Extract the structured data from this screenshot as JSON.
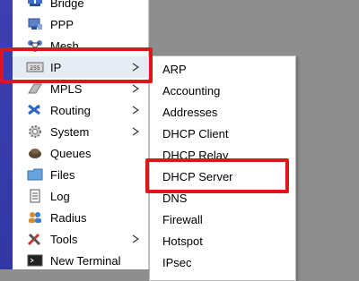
{
  "main_menu": {
    "items": [
      {
        "label": "Bridge",
        "icon": "bridge-icon",
        "has_submenu": false
      },
      {
        "label": "PPP",
        "icon": "ppp-icon",
        "has_submenu": false
      },
      {
        "label": "Mesh",
        "icon": "mesh-icon",
        "has_submenu": false
      },
      {
        "label": "IP",
        "icon": "ip-icon",
        "has_submenu": true,
        "selected": true
      },
      {
        "label": "MPLS",
        "icon": "mpls-icon",
        "has_submenu": true
      },
      {
        "label": "Routing",
        "icon": "routing-icon",
        "has_submenu": true
      },
      {
        "label": "System",
        "icon": "system-icon",
        "has_submenu": true
      },
      {
        "label": "Queues",
        "icon": "queues-icon",
        "has_submenu": false
      },
      {
        "label": "Files",
        "icon": "files-icon",
        "has_submenu": false
      },
      {
        "label": "Log",
        "icon": "log-icon",
        "has_submenu": false
      },
      {
        "label": "Radius",
        "icon": "radius-icon",
        "has_submenu": false
      },
      {
        "label": "Tools",
        "icon": "tools-icon",
        "has_submenu": true
      },
      {
        "label": "New Terminal",
        "icon": "terminal-icon",
        "has_submenu": false
      }
    ]
  },
  "ip_submenu": {
    "items": [
      {
        "label": "ARP"
      },
      {
        "label": "Accounting"
      },
      {
        "label": "Addresses"
      },
      {
        "label": "DHCP Client"
      },
      {
        "label": "DHCP Relay"
      },
      {
        "label": "DHCP Server",
        "highlighted": true
      },
      {
        "label": "DNS"
      },
      {
        "label": "Firewall"
      },
      {
        "label": "Hotspot"
      },
      {
        "label": "IPsec"
      }
    ]
  },
  "colors": {
    "sidebar": "#3337a6",
    "highlight": "#e0141b",
    "selected_row": "#e6ecf3"
  }
}
